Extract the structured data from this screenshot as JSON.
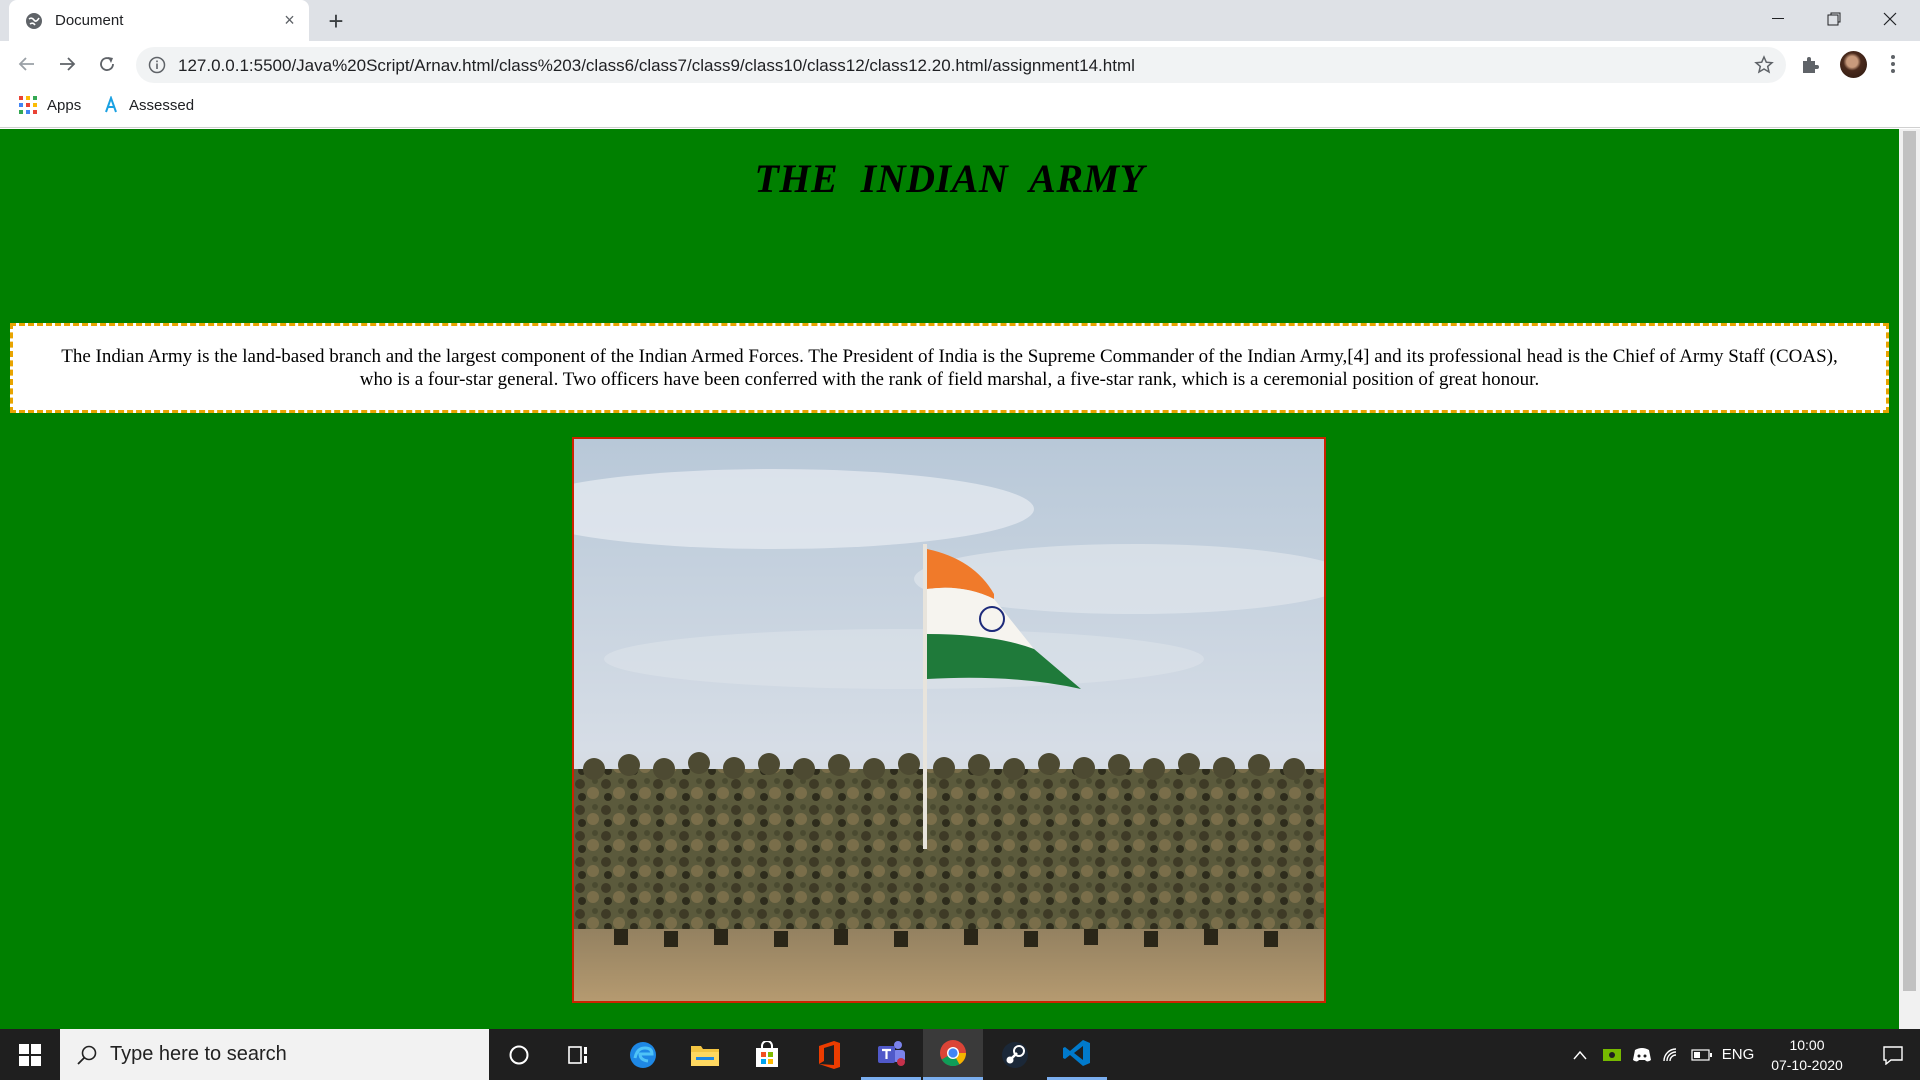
{
  "browser": {
    "tab": {
      "title": "Document",
      "favicon": "globe-icon",
      "close": "×"
    },
    "new_tab": "+",
    "url": "127.0.0.1:5500/Java%20Script/Arnav.html/class%203/class6/class7/class9/class10/class12/class12.20.html/assignment14.html",
    "bookmarks": [
      {
        "label": "Apps",
        "icon": "apps-grid-icon"
      },
      {
        "label": "Assessed",
        "icon": "assessed-icon"
      }
    ]
  },
  "page": {
    "background": "#008000",
    "heading": "THE  INDIAN  ARMY",
    "paragraph_line1": "The Indian Army is the land-based branch and the largest component of the Indian Armed Forces. The President of India is the Supreme Commander of the Indian Army,[4] and its professional head is the Chief of Army Staff (COAS),",
    "paragraph_line2": "who is a four-star general. Two officers have been conferred with the rank of field marshal, a five-star rank, which is a ceremonial position of great honour.",
    "paragraph_border_color": "#e8a400",
    "image_border_color": "#cc2200",
    "image_subject": "indian-army-soldiers-with-flag"
  },
  "taskbar": {
    "search_placeholder": "Type here to search",
    "apps": [
      "cortana-icon",
      "task-view-icon",
      "edge-icon",
      "file-explorer-icon",
      "store-icon",
      "office-icon",
      "teams-icon",
      "chrome-icon",
      "steam-icon",
      "vscode-icon"
    ],
    "language": "ENG",
    "time": "10:00",
    "date": "07-10-2020"
  }
}
